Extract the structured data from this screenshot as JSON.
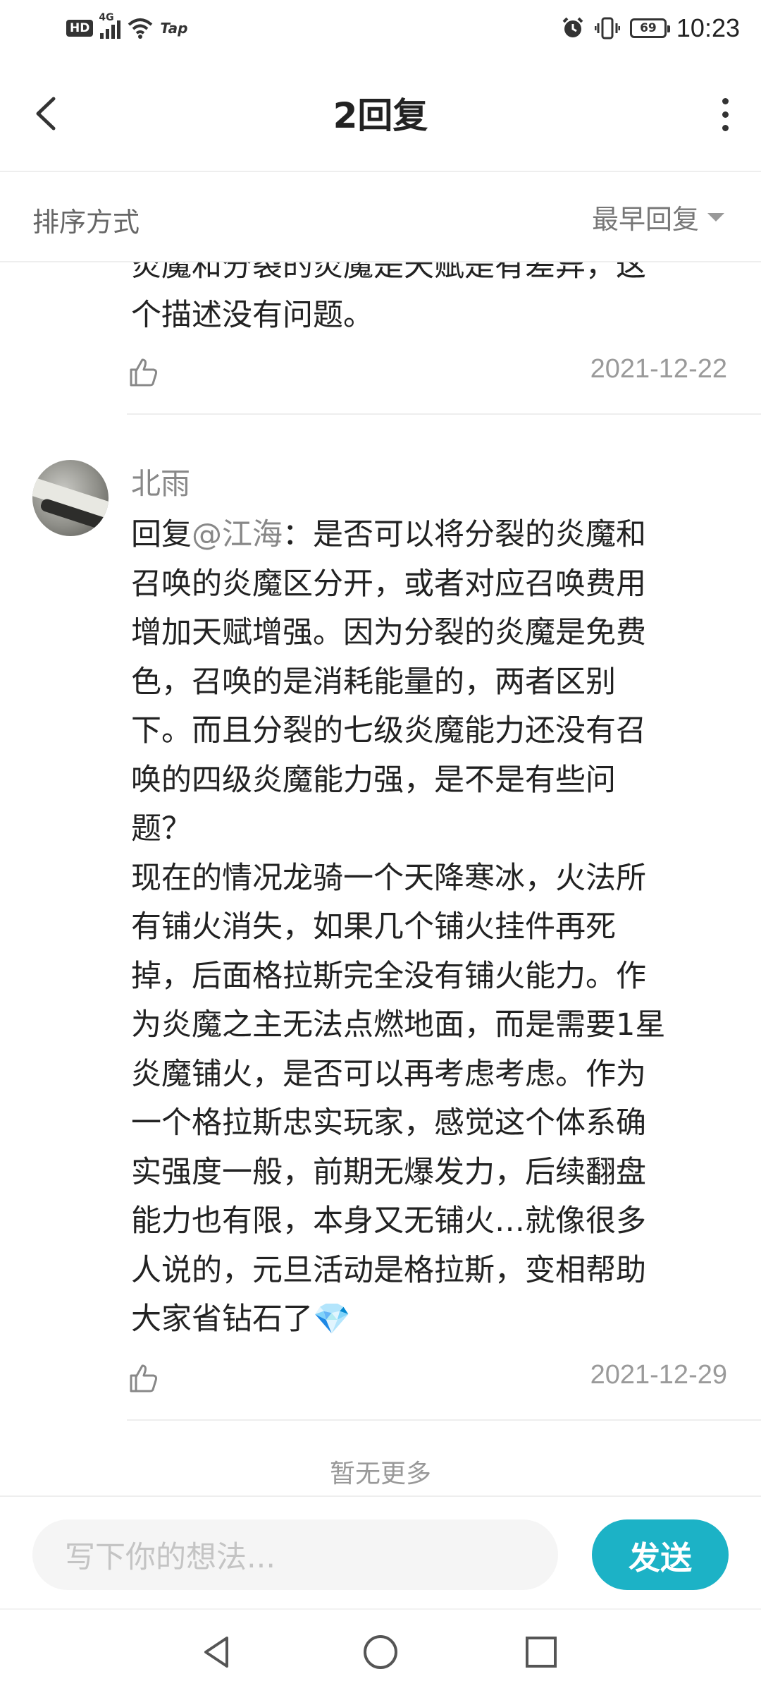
{
  "status_bar": {
    "hd": "HD",
    "network": "4G",
    "tap": "Tap",
    "battery": "69",
    "time": "10:23"
  },
  "header": {
    "title": "2回复"
  },
  "sort": {
    "label": "排序方式",
    "value": "最早回复"
  },
  "comments": [
    {
      "text_visible": "炎魔和分裂的炎魔是天赋是有差异，这\n个描述没有问题。",
      "date": "2021-12-22"
    },
    {
      "username": "北雨",
      "reply_prefix": "回复",
      "mention": "@江海",
      "text": "：是否可以将分裂的炎魔和\n召唤的炎魔区分开，或者对应召唤费用\n增加天赋增强。因为分裂的炎魔是免费\n色，召唤的是消耗能量的，两者区别\n下。而且分裂的七级炎魔能力还没有召\n唤的四级炎魔能力强，是不是有些问\n题？\n现在的情况龙骑一个天降寒冰，火法所\n有铺火消失，如果几个铺火挂件再死\n掉，后面格拉斯完全没有铺火能力。作\n为炎魔之主无法点燃地面，而是需要1星\n炎魔铺火，是否可以再考虑考虑。作为\n一个格拉斯忠实玩家，感觉这个体系确\n实强度一般，前期无爆发力，后续翻盘\n能力也有限，本身又无铺火…就像很多\n人说的，元旦活动是格拉斯，变相帮助\n大家省钻石了",
      "emoji": "💎",
      "date": "2021-12-29"
    }
  ],
  "footer_note": "暂无更多",
  "input": {
    "placeholder": "写下你的想法...",
    "send_label": "发送"
  },
  "colors": {
    "accent": "#1cb2c6",
    "muted_text": "#888888",
    "divider": "#eeeeee"
  },
  "icons": {
    "back": "chevron-left-icon",
    "more": "more-vertical-icon",
    "like": "thumbs-up-icon",
    "nav_back": "triangle-back-icon",
    "nav_home": "circle-home-icon",
    "nav_recent": "square-recent-icon"
  }
}
